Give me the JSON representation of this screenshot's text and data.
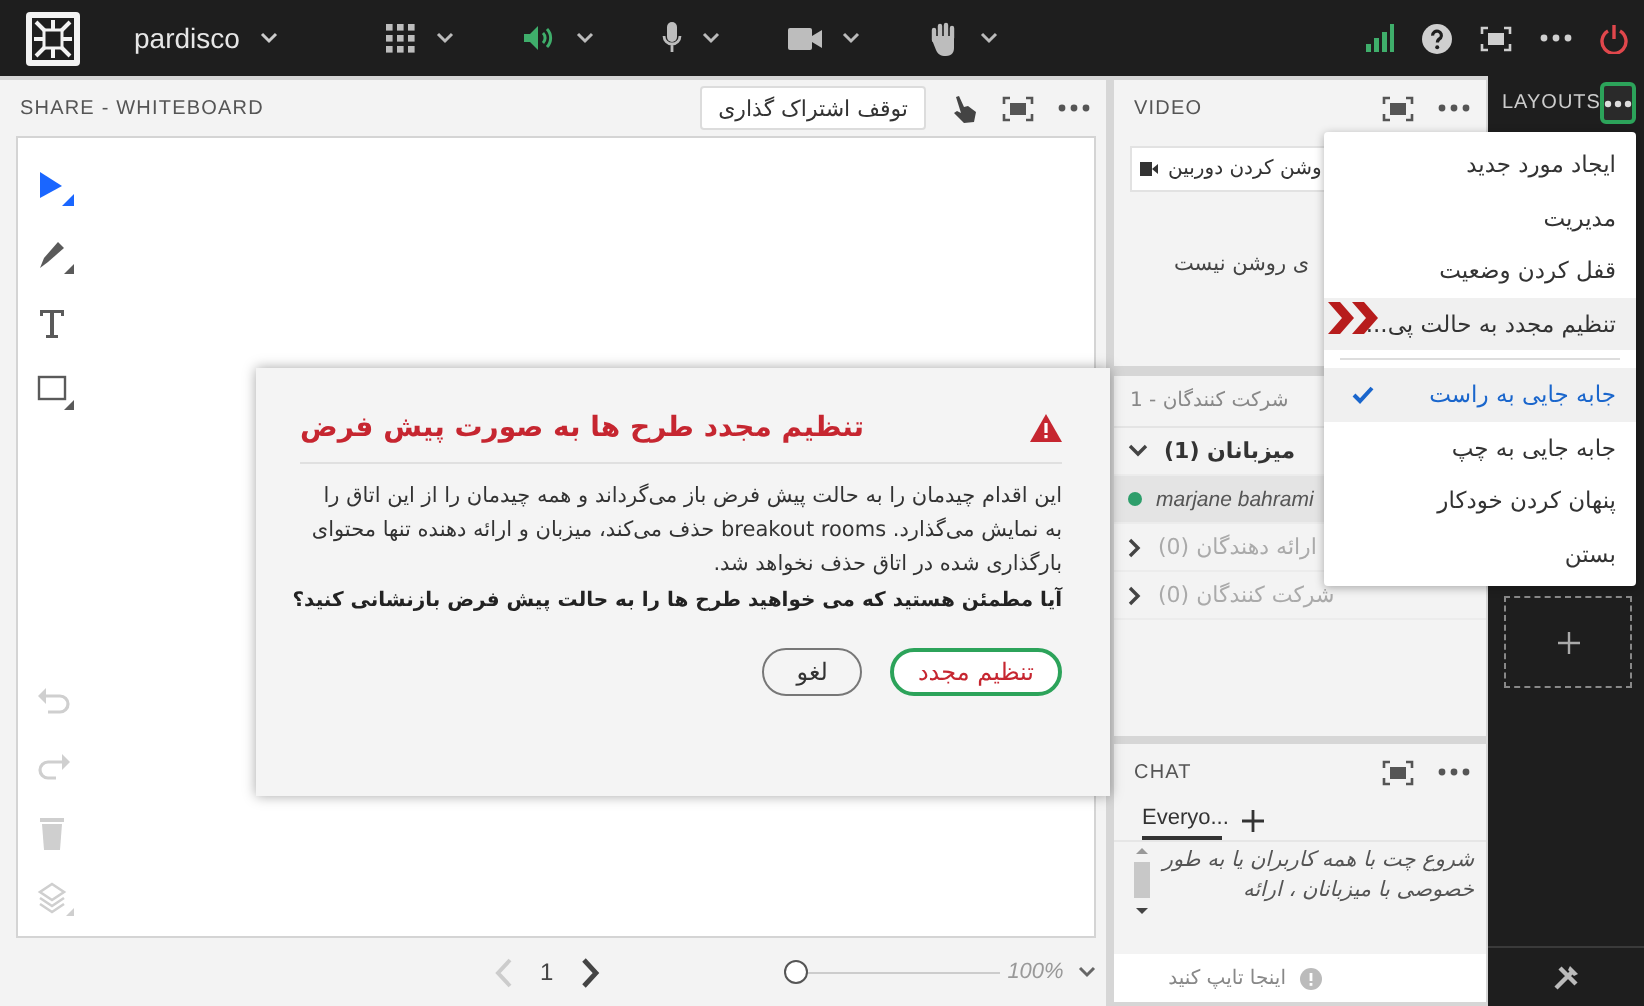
{
  "topbar": {
    "meeting_name": "pardisco",
    "controls": [
      {
        "kind": "apps",
        "on": false
      },
      {
        "kind": "speaker",
        "on": true
      },
      {
        "kind": "mic",
        "on": false
      },
      {
        "kind": "camera",
        "on": false
      },
      {
        "kind": "hand",
        "on": false
      }
    ]
  },
  "whiteboard": {
    "title": "SHARE - WHITEBOARD",
    "stop_sharing_button": "توقف اشتراک گذاری",
    "tools": [
      {
        "kind": "select",
        "selected": true
      },
      {
        "kind": "pen",
        "selected": false
      },
      {
        "kind": "text",
        "selected": false
      },
      {
        "kind": "shape",
        "selected": false
      }
    ],
    "actions": [
      {
        "kind": "undo",
        "disabled": true
      },
      {
        "kind": "redo",
        "disabled": true
      },
      {
        "kind": "delete",
        "disabled": true
      },
      {
        "kind": "layers",
        "disabled": true
      }
    ],
    "pager": {
      "page": "1",
      "prev_disabled": true
    },
    "zoom": {
      "level": 0,
      "reading": "100%"
    }
  },
  "video": {
    "title": "VIDEO",
    "camera_button": "وشن کردن دوربین",
    "message": "ی روشن نیست"
  },
  "participants": {
    "title": "شرکت کنندگان - 1",
    "groups": [
      {
        "label": "میزبانان (1)",
        "expanded": true,
        "members": [
          {
            "name": "marjane bahrami"
          }
        ]
      },
      {
        "label": "ارائه دهندگان (0)",
        "expanded": false
      },
      {
        "label": "شرکت کنندگان (0)",
        "expanded": false
      }
    ]
  },
  "chat": {
    "title": "CHAT",
    "tabs": [
      {
        "label": "Everyo...",
        "selected": true
      }
    ],
    "message": "شروع چت با همه کاربران یا به طور خصوصی با میزبانان ، ارائه",
    "placeholder": "اینجا تایپ کنید"
  },
  "layouts": {
    "title": "LAYOUTS",
    "menu_open": true
  },
  "dialog": {
    "title": "تنظیم مجدد طرح ها به صورت پیش فرض",
    "body": "این اقدام چیدمان را به حالت پیش فرض باز می‌گرداند و همه چیدمان را از این اتاق را به نمایش می‌گذارد. breakout rooms حذف می‌کند، میزبان و ارائه دهنده تنها محتوای بارگذاری شده در اتاق حذف نخواهد شد.",
    "question": "آیا مطمئن هستید که می خواهید طرح ها را به حالت پیش فرض بازنشانی کنید؟",
    "buttons": [
      {
        "kind": "confirm",
        "label": "تنظیم مجدد"
      },
      {
        "kind": "cancel",
        "label": "لغو"
      }
    ]
  },
  "menu": {
    "sections": [
      [
        {
          "label": "ایجاد مورد جدید",
          "selected": false,
          "highlighted": false
        },
        {
          "label": "مدیریت",
          "selected": false,
          "highlighted": false
        },
        {
          "label": "قفل کردن وضعیت",
          "selected": false,
          "highlighted": false
        },
        {
          "label": "تنظیم مجدد به حالت پی...",
          "selected": false,
          "highlighted": true
        }
      ],
      [
        {
          "label": "جابه جایی به راست",
          "selected": true,
          "highlighted": false
        },
        {
          "label": "جابه جایی به چپ",
          "selected": false,
          "highlighted": false
        },
        {
          "label": "پنهان کردن خودکار",
          "selected": false,
          "highlighted": false
        },
        {
          "label": "بستن",
          "selected": false,
          "highlighted": false
        }
      ]
    ]
  }
}
